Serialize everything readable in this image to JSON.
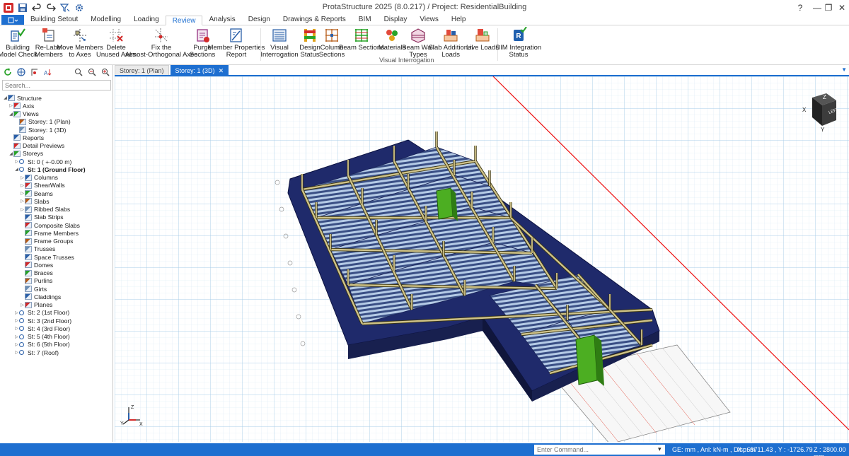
{
  "window": {
    "title": "ProtaStructure 2025 (8.0.217) / Project: ResidentialBuilding",
    "controls": {
      "help": "?",
      "minimize": "—",
      "restore": "❐",
      "close": "✕"
    }
  },
  "ribbon_tabs": [
    {
      "label": "Building Setout"
    },
    {
      "label": "Modelling"
    },
    {
      "label": "Loading"
    },
    {
      "label": "Review"
    },
    {
      "label": "Analysis"
    },
    {
      "label": "Design"
    },
    {
      "label": "Drawings & Reports"
    },
    {
      "label": "BIM"
    },
    {
      "label": "Display"
    },
    {
      "label": "Views"
    },
    {
      "label": "Help"
    }
  ],
  "active_tab": "Review",
  "ribbon_buttons": [
    {
      "label": "Building\nModel Check",
      "icon": "model-check-icon"
    },
    {
      "label": "Re-Label\nMembers",
      "icon": "relabel-icon"
    },
    {
      "label": "Move Members\nto Axes",
      "icon": "move-members-icon"
    },
    {
      "label": "Delete\nUnused Axes",
      "icon": "delete-axes-icon"
    },
    {
      "label": "Fix the\nAlmost-Orthogonal Axes",
      "icon": "fix-axes-icon"
    },
    {
      "label": "Purge\nSections",
      "icon": "purge-icon"
    },
    {
      "label": "Member Properties\nReport",
      "icon": "report-icon"
    },
    {
      "label": "Visual\nInterrogation",
      "icon": "visual-interrogation-icon"
    },
    {
      "label": "Design\nStatus",
      "icon": "design-status-icon"
    },
    {
      "label": "Column\nSections",
      "icon": "column-sections-icon"
    },
    {
      "label": "Beam Sections",
      "icon": "beam-sections-icon"
    },
    {
      "label": "Materials",
      "icon": "materials-icon"
    },
    {
      "label": "Beam Wall\nTypes",
      "icon": "beam-wall-icon"
    },
    {
      "label": "Slab Additional\nLoads",
      "icon": "slab-loads-icon"
    },
    {
      "label": "Live Loads",
      "icon": "live-loads-icon"
    },
    {
      "label": "BIM Integration\nStatus",
      "icon": "bim-status-icon"
    }
  ],
  "ribbon_group": "Visual Interrogation",
  "tree": {
    "search_placeholder": "Search...",
    "nodes": [
      {
        "label": "Structure",
        "level": 0,
        "expand": "open"
      },
      {
        "label": "Axis",
        "level": 1,
        "expand": "closed"
      },
      {
        "label": "Views",
        "level": 1,
        "expand": "open"
      },
      {
        "label": "Storey: 1 (Plan)",
        "level": 2,
        "expand": "none"
      },
      {
        "label": "Storey: 1 (3D)",
        "level": 2,
        "expand": "none"
      },
      {
        "label": "Reports",
        "level": 1,
        "expand": "none"
      },
      {
        "label": "Detail Previews",
        "level": 1,
        "expand": "none"
      },
      {
        "label": "Storeys",
        "level": 1,
        "expand": "open"
      },
      {
        "label": "St: 0 ( +-0.00 m)",
        "level": 2,
        "expand": "closed"
      },
      {
        "label": "St: 1 (Ground Floor)",
        "level": 2,
        "expand": "open",
        "bold": true
      },
      {
        "label": "Columns",
        "level": 3,
        "expand": "closed"
      },
      {
        "label": "ShearWalls",
        "level": 3,
        "expand": "closed"
      },
      {
        "label": "Beams",
        "level": 3,
        "expand": "closed"
      },
      {
        "label": "Slabs",
        "level": 3,
        "expand": "closed"
      },
      {
        "label": "Ribbed Slabs",
        "level": 3,
        "expand": "closed"
      },
      {
        "label": "Slab Strips",
        "level": 3,
        "expand": "none"
      },
      {
        "label": "Composite Slabs",
        "level": 3,
        "expand": "none"
      },
      {
        "label": "Frame Members",
        "level": 3,
        "expand": "none"
      },
      {
        "label": "Frame Groups",
        "level": 3,
        "expand": "none"
      },
      {
        "label": "Trusses",
        "level": 3,
        "expand": "none"
      },
      {
        "label": "Space Trusses",
        "level": 3,
        "expand": "none"
      },
      {
        "label": "Domes",
        "level": 3,
        "expand": "none"
      },
      {
        "label": "Braces",
        "level": 3,
        "expand": "none"
      },
      {
        "label": "Purlins",
        "level": 3,
        "expand": "none"
      },
      {
        "label": "Girts",
        "level": 3,
        "expand": "none"
      },
      {
        "label": "Claddings",
        "level": 3,
        "expand": "none"
      },
      {
        "label": "Planes",
        "level": 3,
        "expand": "closed"
      },
      {
        "label": "St: 2 (1st Floor)",
        "level": 2,
        "expand": "closed"
      },
      {
        "label": "St: 3 (2nd Floor)",
        "level": 2,
        "expand": "closed"
      },
      {
        "label": "St: 4 (3rd Floor)",
        "level": 2,
        "expand": "closed"
      },
      {
        "label": "St: 5 (4th Floor)",
        "level": 2,
        "expand": "closed"
      },
      {
        "label": "St: 6 (5th Floor)",
        "level": 2,
        "expand": "closed"
      },
      {
        "label": "St: 7 (Roof)",
        "level": 2,
        "expand": "closed"
      }
    ]
  },
  "doc_tabs": [
    {
      "label": "Storey: 1 (Plan)",
      "active": false
    },
    {
      "label": "Storey: 1 (3D)",
      "active": true
    }
  ],
  "viewcube": {
    "face": "LEFT",
    "axes": [
      "Z",
      "X",
      "Y"
    ]
  },
  "axis_triad": {
    "labels": [
      "Z",
      "Y",
      "X"
    ]
  },
  "status": {
    "command_placeholder": "Enter Command...",
    "units": "GE: mm , Anl: kN-m , Disp: m",
    "coords": "X : 65711.43 , Y : -1726.79",
    "z": "Z : 2800.00 mm"
  },
  "colors": {
    "accent": "#1e6fd0",
    "beam": "#b3ab78",
    "slab_rib": "#6c8fb5",
    "shear_wall": "#4cae22",
    "grid": "#b9d8ee",
    "axis_red": "#e11"
  }
}
